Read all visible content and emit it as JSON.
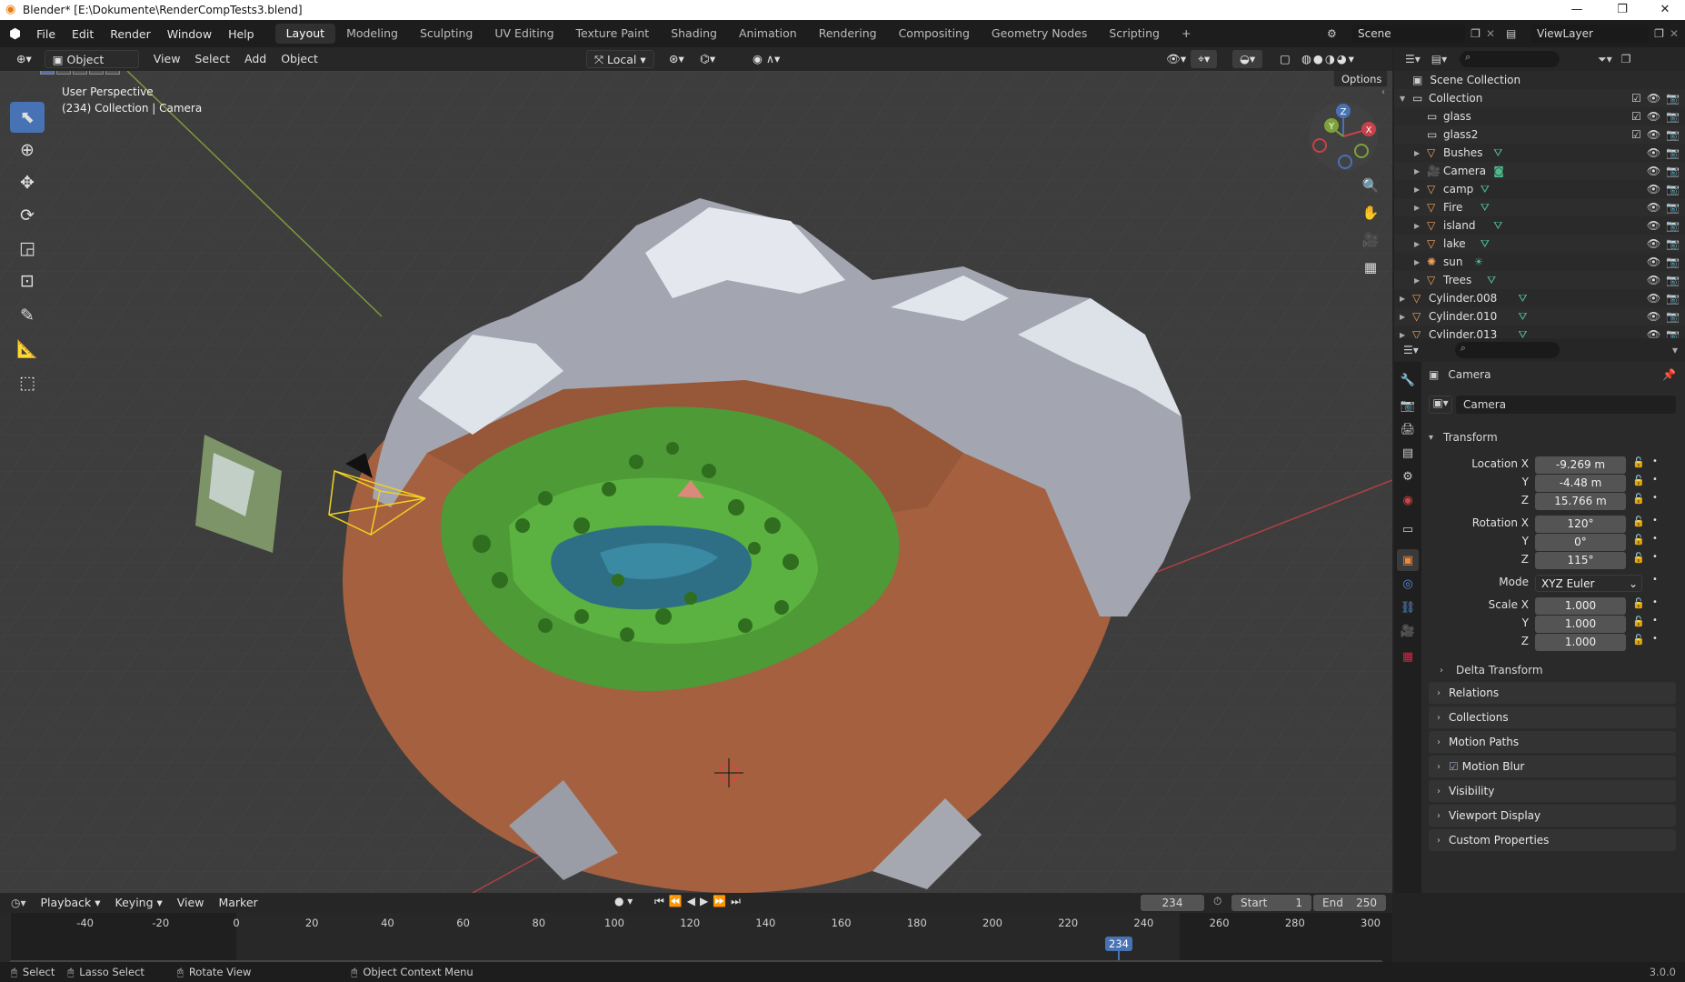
{
  "title": "Blender* [E:\\Dokumente\\RenderCompTests3.blend]",
  "window_controls": [
    "—",
    "❐",
    "✕"
  ],
  "menu": [
    "File",
    "Edit",
    "Render",
    "Window",
    "Help"
  ],
  "workspaces": [
    "Layout",
    "Modeling",
    "Sculpting",
    "UV Editing",
    "Texture Paint",
    "Shading",
    "Animation",
    "Rendering",
    "Compositing",
    "Geometry Nodes",
    "Scripting"
  ],
  "active_workspace": "Layout",
  "add_workspace": "+",
  "scene": "Scene",
  "view_layer": "ViewLayer",
  "header": {
    "mode": "Object Mode",
    "view": "View",
    "select": "Select",
    "add": "Add",
    "object": "Object",
    "orientation": "Local",
    "options": "Options"
  },
  "overlay": {
    "line1": "User Perspective",
    "line2": "(234) Collection | Camera"
  },
  "gizmo": {
    "x": "X",
    "y": "Y",
    "z": "Z"
  },
  "outliner": {
    "root": "Scene Collection",
    "items": [
      {
        "name": "Collection",
        "kind": "collection",
        "depth": 0,
        "checkbox": true
      },
      {
        "name": "glass",
        "kind": "collection",
        "depth": 1,
        "checkbox": true
      },
      {
        "name": "glass2",
        "kind": "collection",
        "depth": 1,
        "checkbox": true
      },
      {
        "name": "Bushes",
        "kind": "mesh",
        "depth": 1
      },
      {
        "name": "Camera",
        "kind": "camera",
        "depth": 1
      },
      {
        "name": "camp",
        "kind": "mesh",
        "depth": 1
      },
      {
        "name": "Fire",
        "kind": "mesh",
        "depth": 1
      },
      {
        "name": "island",
        "kind": "mesh",
        "depth": 1
      },
      {
        "name": "lake",
        "kind": "mesh",
        "depth": 1
      },
      {
        "name": "sun",
        "kind": "light",
        "depth": 1
      },
      {
        "name": "Trees",
        "kind": "mesh",
        "depth": 1
      },
      {
        "name": "Cylinder.008",
        "kind": "mesh",
        "depth": 0
      },
      {
        "name": "Cylinder.010",
        "kind": "mesh",
        "depth": 0
      },
      {
        "name": "Cylinder.013",
        "kind": "mesh",
        "depth": 0
      }
    ]
  },
  "properties": {
    "object_name": "Camera",
    "data_name": "Camera",
    "transform_label": "Transform",
    "location_label": "Location X",
    "location": [
      "-9.269 m",
      "-4.48 m",
      "15.766 m"
    ],
    "rotation_label": "Rotation X",
    "rotation": [
      "120°",
      "0°",
      "115°"
    ],
    "mode_label": "Mode",
    "mode": "XYZ Euler",
    "scale_label": "Scale X",
    "scale": [
      "1.000",
      "1.000",
      "1.000"
    ],
    "y": "Y",
    "z": "Z",
    "delta": "Delta Transform",
    "panels": [
      "Relations",
      "Collections",
      "Motion Paths",
      "Motion Blur",
      "Visibility",
      "Viewport Display",
      "Custom Properties"
    ]
  },
  "timeline": {
    "playback": "Playback",
    "keying": "Keying",
    "view": "View",
    "marker": "Marker",
    "current": "234",
    "start_label": "Start",
    "start": "1",
    "end_label": "End",
    "end": "250",
    "ticks": [
      "-40",
      "-20",
      "0",
      "20",
      "40",
      "60",
      "80",
      "100",
      "120",
      "140",
      "160",
      "180",
      "200",
      "220",
      "240",
      "260",
      "280",
      "300"
    ]
  },
  "status": {
    "select": "Select",
    "lasso": "Lasso Select",
    "rotate": "Rotate View",
    "context": "Object Context Menu",
    "version": "3.0.0"
  },
  "colors": {
    "accent": "#4772b3",
    "bg": "#3d3d3d",
    "rock": "#a7a9b2",
    "snow": "#dfe4ea",
    "earth": "#a5603f",
    "grass": "#4e9a36",
    "water": "#2e6f86"
  }
}
